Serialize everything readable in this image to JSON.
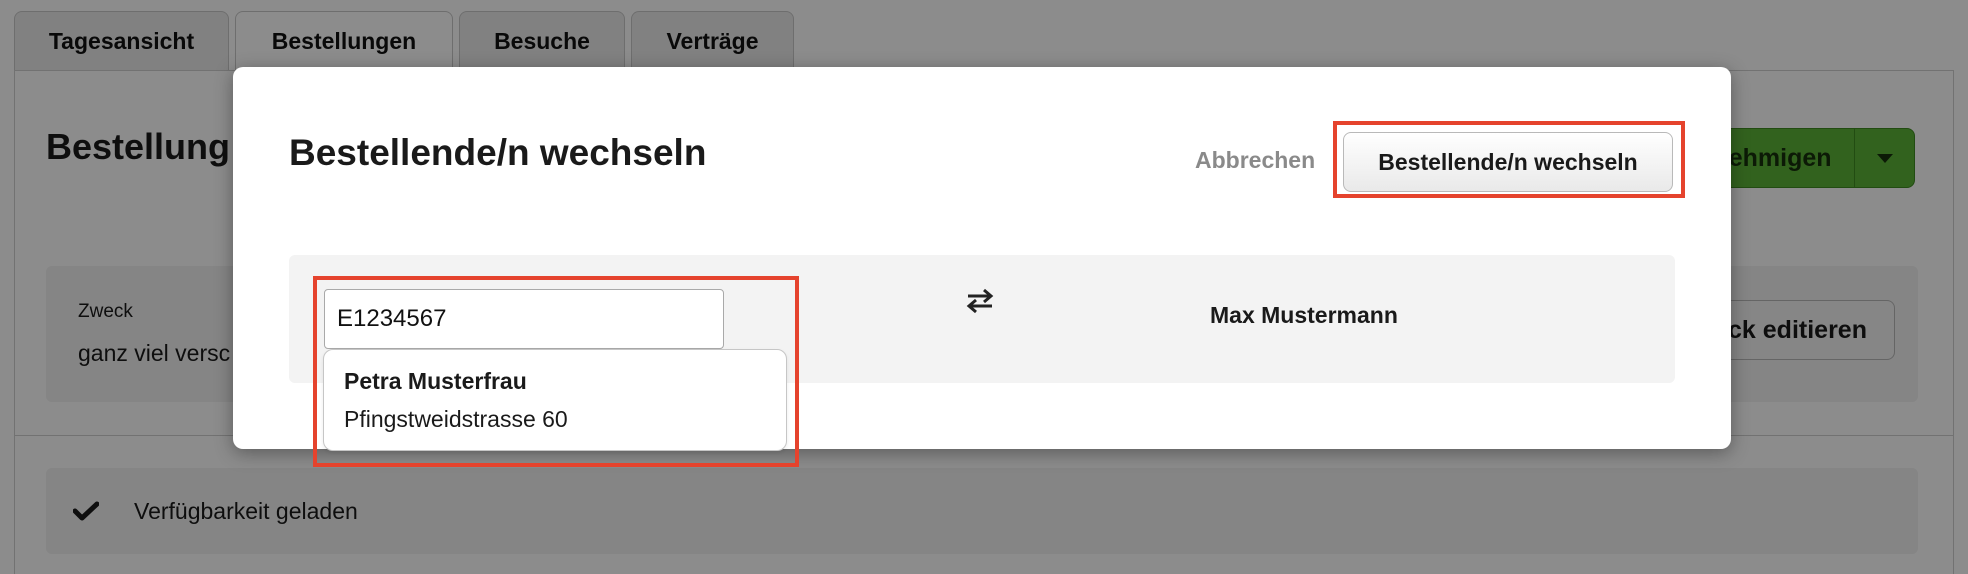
{
  "tabs": [
    {
      "label": "Tagesansicht"
    },
    {
      "label": "Bestellungen"
    },
    {
      "label": "Besuche"
    },
    {
      "label": "Verträge"
    }
  ],
  "background": {
    "title": "Bestellung",
    "approve_label": "nehmigen",
    "purpose_label": "Zweck",
    "purpose_text": "ganz viel versc",
    "edit_label": "ck editieren",
    "availability_text": "Verfügbarkeit geladen"
  },
  "modal": {
    "title": "Bestellende/n wechseln",
    "cancel_label": "Abbrechen",
    "confirm_label": "Bestellende/n wechseln",
    "search_value": "E1234567",
    "current_person": "Max Mustermann",
    "suggestion": {
      "name": "Petra Musterfrau",
      "address": "Pfingstweidstrasse 60"
    }
  },
  "icons": {
    "swap": "swap-arrows-icon",
    "check": "check-icon",
    "caret": "caret-down-icon"
  },
  "colors": {
    "highlight": "#e5432d",
    "approve_green": "#5cb338",
    "overlay": "rgba(0,0,0,0.45)"
  }
}
